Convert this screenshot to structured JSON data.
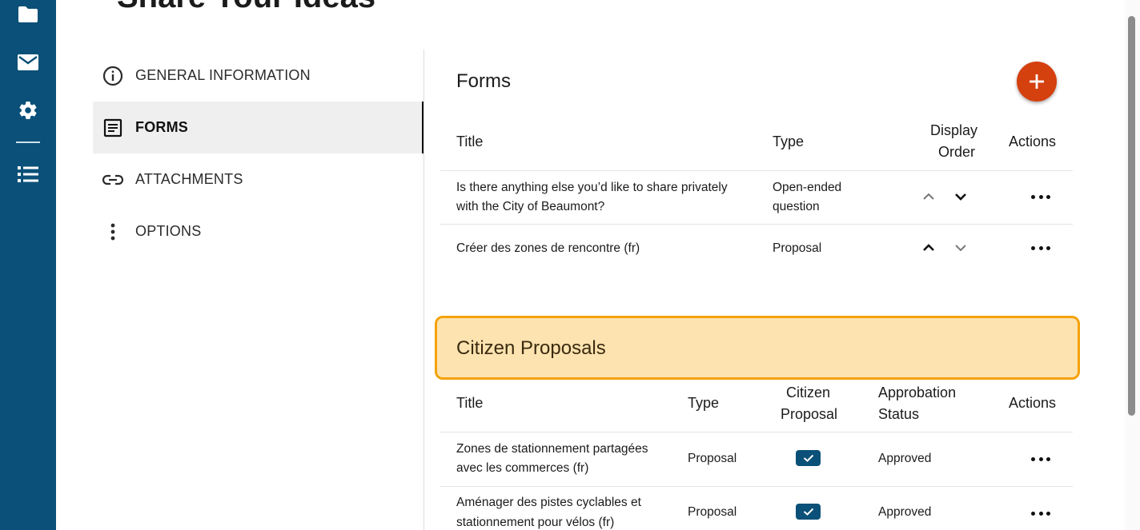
{
  "page": {
    "title": "Share Your Ideas"
  },
  "rail": {
    "icons": [
      "folder-icon",
      "mail-icon",
      "gear-icon",
      "list-icon"
    ]
  },
  "side_menu": {
    "items": [
      {
        "label": "GENERAL INFORMATION",
        "icon": "info-icon"
      },
      {
        "label": "FORMS",
        "icon": "form-icon",
        "active": true
      },
      {
        "label": "ATTACHMENTS",
        "icon": "link-icon"
      },
      {
        "label": "OPTIONS",
        "icon": "more-vertical-icon"
      }
    ]
  },
  "forms": {
    "title": "Forms",
    "add_icon": "plus-icon",
    "columns": {
      "title": "Title",
      "type": "Type",
      "order_line1": "Display",
      "order_line2": "Order",
      "actions": "Actions"
    },
    "rows": [
      {
        "title_line1": "Is there anything else you’d like to share privately",
        "title_line2": "with the City of Beaumont?",
        "type_line1": "Open-ended",
        "type_line2": "question"
      },
      {
        "title_line1": "Créer des zones de rencontre (fr)",
        "type_line1": "Proposal"
      }
    ]
  },
  "citizen_proposals": {
    "title": "Citizen Proposals",
    "columns": {
      "title": "Title",
      "type": "Type",
      "citizen_line1": "Citizen",
      "citizen_line2": "Proposal",
      "status_line1": "Approbation",
      "status_line2": "Status",
      "actions": "Actions"
    },
    "rows": [
      {
        "title_line1": "Zones de stationnement partagées",
        "title_line2": "avec les commerces (fr)",
        "type": "Proposal",
        "citizen_proposal": true,
        "status": "Approved"
      },
      {
        "title_line1": "Aménager des pistes cyclables et",
        "title_line2": "stationnement pour vélos (fr)",
        "type": "Proposal",
        "citizen_proposal": true,
        "status": "Approved"
      }
    ]
  },
  "colors": {
    "rail": "#0b5078",
    "accent": "#d5400f",
    "highlight_bg": "#fde3b0",
    "highlight_border": "#f5a20c"
  }
}
